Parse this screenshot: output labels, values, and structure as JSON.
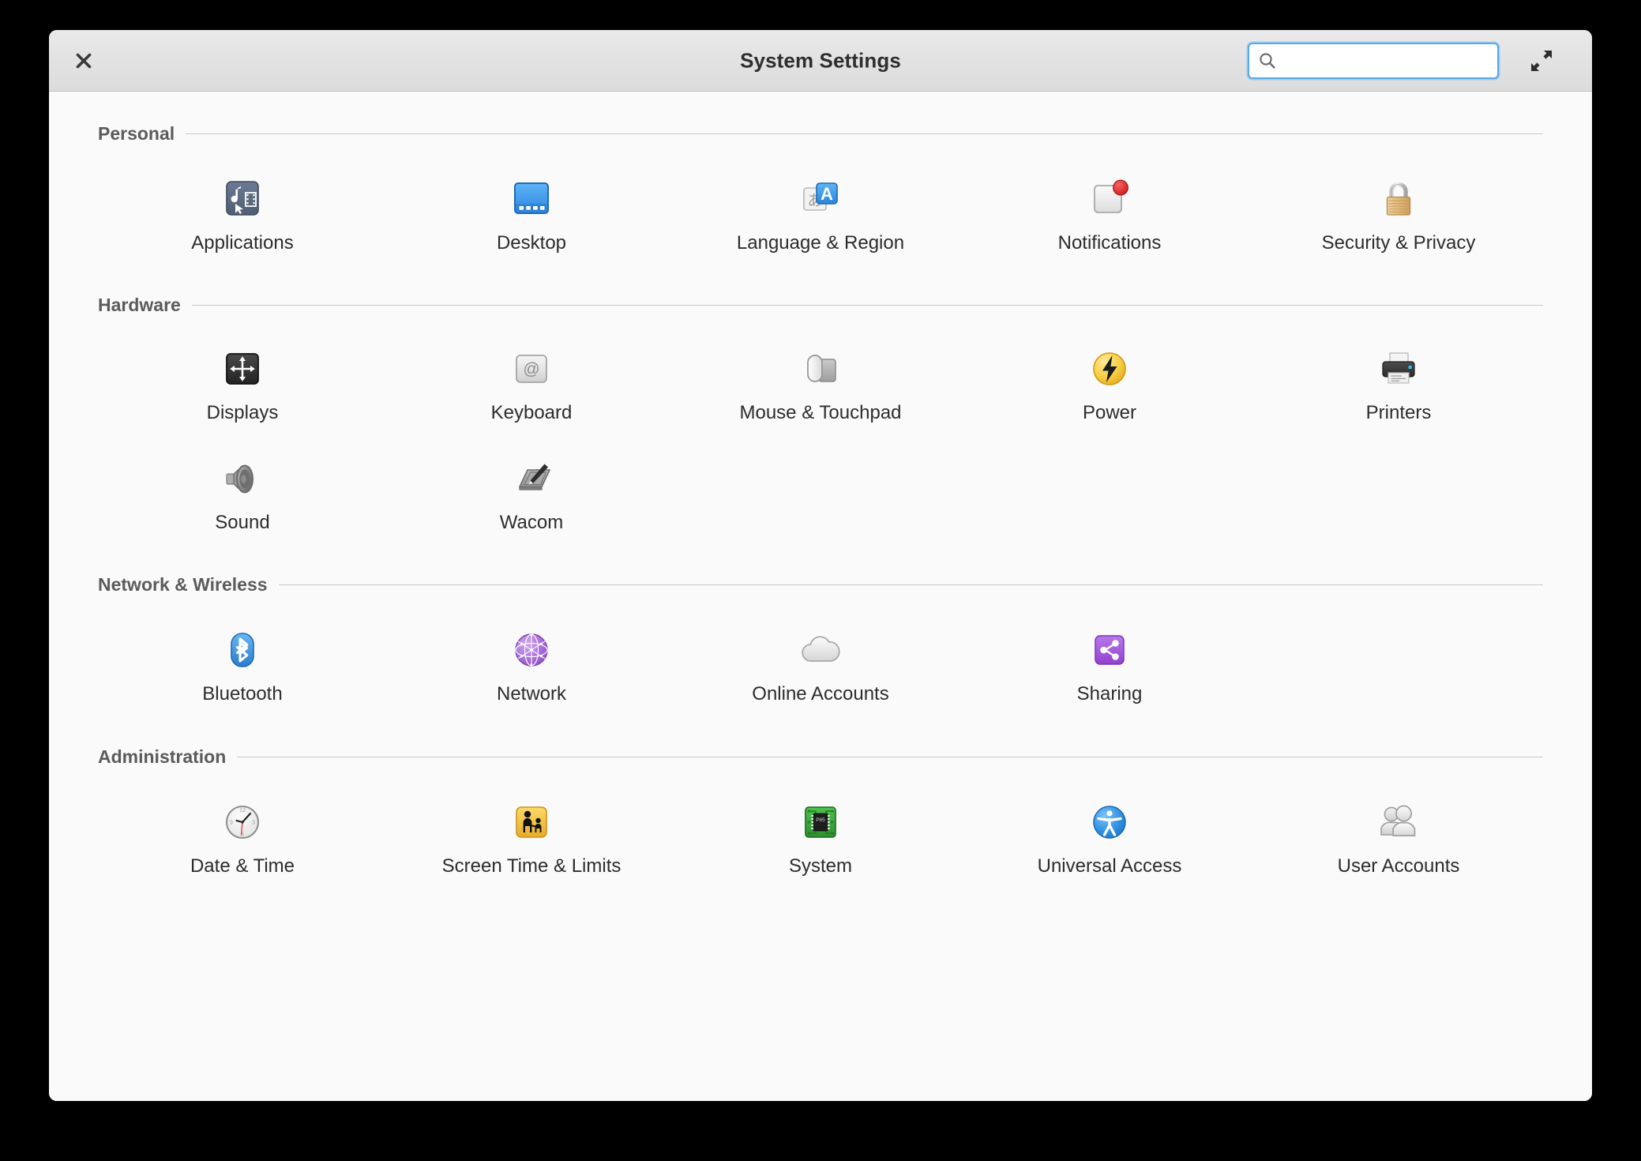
{
  "window": {
    "title": "System Settings",
    "close_icon": "close-icon",
    "expand_icon": "expand-diagonal-icon"
  },
  "search": {
    "value": "",
    "placeholder": "",
    "icon": "search-icon"
  },
  "sections": [
    {
      "id": "personal",
      "title": "Personal",
      "items": [
        {
          "label": "Applications",
          "icon": "applications-icon"
        },
        {
          "label": "Desktop",
          "icon": "desktop-icon"
        },
        {
          "label": "Language & Region",
          "icon": "language-region-icon"
        },
        {
          "label": "Notifications",
          "icon": "notifications-icon"
        },
        {
          "label": "Security & Privacy",
          "icon": "padlock-icon"
        }
      ]
    },
    {
      "id": "hardware",
      "title": "Hardware",
      "items": [
        {
          "label": "Displays",
          "icon": "displays-icon"
        },
        {
          "label": "Keyboard",
          "icon": "keyboard-icon"
        },
        {
          "label": "Mouse & Touchpad",
          "icon": "mouse-touchpad-icon"
        },
        {
          "label": "Power",
          "icon": "power-bolt-icon"
        },
        {
          "label": "Printers",
          "icon": "printer-icon"
        },
        {
          "label": "Sound",
          "icon": "speaker-icon"
        },
        {
          "label": "Wacom",
          "icon": "wacom-tablet-icon"
        }
      ]
    },
    {
      "id": "network",
      "title": "Network & Wireless",
      "items": [
        {
          "label": "Bluetooth",
          "icon": "bluetooth-icon"
        },
        {
          "label": "Network",
          "icon": "network-globe-icon"
        },
        {
          "label": "Online Accounts",
          "icon": "cloud-icon"
        },
        {
          "label": "Sharing",
          "icon": "share-icon"
        }
      ]
    },
    {
      "id": "administration",
      "title": "Administration",
      "items": [
        {
          "label": "Date & Time",
          "icon": "clock-icon"
        },
        {
          "label": "Screen Time & Limits",
          "icon": "parental-controls-icon"
        },
        {
          "label": "System",
          "icon": "cpu-chip-icon"
        },
        {
          "label": "Universal Access",
          "icon": "accessibility-icon"
        },
        {
          "label": "User Accounts",
          "icon": "users-icon"
        }
      ]
    }
  ],
  "colors": {
    "window_background": "#fafafa",
    "titlebar": "#e4e4e4",
    "search_focus_ring": "#55aaf0",
    "section_header_text": "#5b5b5b",
    "label_text": "#2c2c2c",
    "applications_icon": "#5d6b82",
    "desktop_icon": "#3d9bf0",
    "language_icon": "#3d9bf0",
    "notification_badge": "#e02b2b",
    "padlock_body": "#e0b97c",
    "power_icon": "#f7cf45",
    "bluetooth_icon": "#3f95e0",
    "network_icon": "#a56cd6",
    "sharing_icon": "#a35be0",
    "screen_time_icon": "#f2c14a",
    "system_icon": "#3aa93a",
    "universal_access_icon": "#2f8fe0"
  }
}
